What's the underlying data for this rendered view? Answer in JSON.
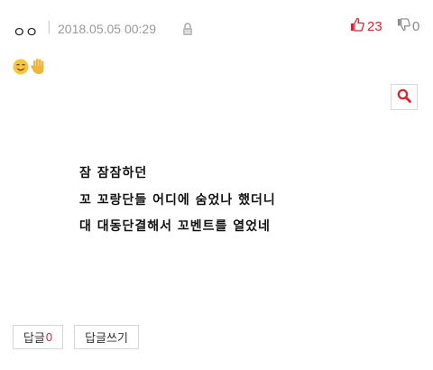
{
  "header": {
    "author": "ㅇㅇ",
    "separator": "|",
    "timestamp": "2018.05.05 00:29",
    "lock_icon": "lock-icon",
    "likes": "23",
    "dislikes": "0",
    "colors": {
      "like": "#d9232f",
      "dislike": "#888888",
      "meta": "#999999"
    }
  },
  "content": {
    "emojis": [
      "smiling-face-emoji",
      "raised-hand-emoji"
    ],
    "search_icon": "search-icon",
    "image_text": [
      "잠 잠잠하던",
      "꼬 꼬랑단들 어디에 숨었나 했더니",
      "대 대동단결해서 꼬벤트를 열었네"
    ]
  },
  "footer": {
    "reply_label": "답글",
    "reply_count": "0",
    "write_reply_label": "답글쓰기"
  }
}
